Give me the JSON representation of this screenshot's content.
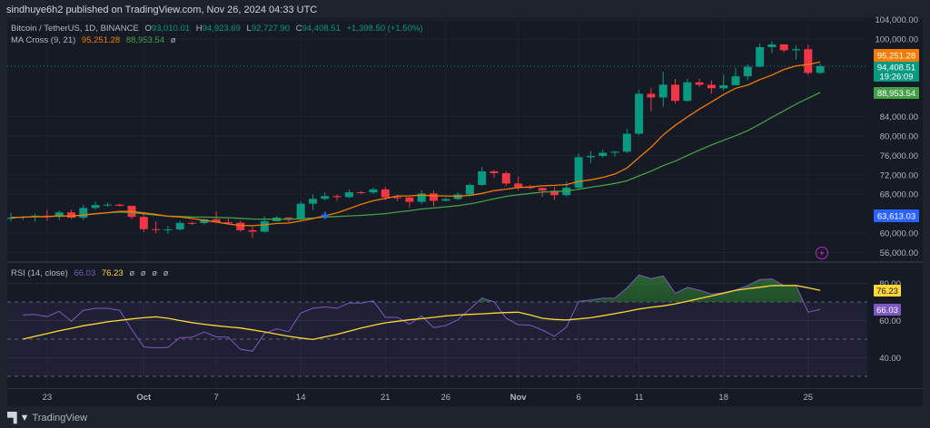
{
  "header": {
    "published": "sindhuye6h2 published on TradingView.com, Nov 26, 2024 04:33 UTC"
  },
  "legend": {
    "symbol": "Bitcoin / TetherUS, 1D, BINANCE",
    "o_label": "O",
    "o": "93,010.01",
    "h_label": "H",
    "h": "94,923.69",
    "l_label": "L",
    "l": "92,727.90",
    "c_label": "C",
    "c": "94,408.51",
    "change": "+1,398.50 (+1.50%)",
    "ma_name": "MA Cross (9, 21)",
    "ma_fast": "95,251.28",
    "ma_slow": "88,953.54",
    "ma_extra": "ø",
    "rsi_name": "RSI (14, close)",
    "rsi": "66.03",
    "rsi_ma": "76.23",
    "rsi_extra": [
      "ø",
      "ø",
      "ø",
      "ø"
    ]
  },
  "colors": {
    "up": "#089981",
    "down": "#f23645",
    "ma_fast": "#f57c00",
    "ma_slow": "#43a047",
    "rsi": "#7e57c2",
    "rsi_ma": "#fdd835",
    "crosshair": "#2962ff"
  },
  "price_axis": {
    "ticks": [
      "104,000.00",
      "100,000.00",
      "84,000.00",
      "80,000.00",
      "76,000.00",
      "72,000.00",
      "68,000.00",
      "60,000.00",
      "56,000.00"
    ],
    "tick_values": [
      104000,
      100000,
      84000,
      80000,
      76000,
      72000,
      68000,
      60000,
      56000
    ],
    "tags": {
      "ma_fast": "95,251.28",
      "last": "94,408.51",
      "countdown": "19:26:09",
      "ma_slow": "88,953.54",
      "crosshair": "63,613.03"
    },
    "last_value": 94408.51,
    "crosshair_value": 63613.03,
    "crosshair_date": "Oct 16"
  },
  "rsi_axis": {
    "ticks": [
      "80.00",
      "60.00",
      "40.00"
    ],
    "tick_values": [
      80,
      60,
      40
    ],
    "bands": [
      70,
      50,
      30
    ],
    "tags": {
      "rsi_ma": "76.23",
      "rsi": "66.03"
    }
  },
  "time_axis": [
    {
      "label": "23",
      "date": "Sep 23"
    },
    {
      "label": "Oct",
      "date": "Oct 1"
    },
    {
      "label": "7",
      "date": "Oct 7"
    },
    {
      "label": "14",
      "date": "Oct 14"
    },
    {
      "label": "21",
      "date": "Oct 21"
    },
    {
      "label": "26",
      "date": "Oct 26"
    },
    {
      "label": "Nov",
      "date": "Nov 1"
    },
    {
      "label": "6",
      "date": "Nov 6"
    },
    {
      "label": "11",
      "date": "Nov 11"
    },
    {
      "label": "18",
      "date": "Nov 18"
    },
    {
      "label": "25",
      "date": "Nov 25"
    }
  ],
  "chart_data": {
    "type": "candlestick",
    "ylim": [
      54000,
      104500
    ],
    "candles_columns": [
      "date",
      "open",
      "high",
      "low",
      "close"
    ],
    "candles": [
      [
        "Sep 20",
        62940,
        64133,
        62350,
        63192
      ],
      [
        "Sep 21",
        63192,
        63560,
        62760,
        63348
      ],
      [
        "Sep 22",
        63348,
        64000,
        62357,
        63578
      ],
      [
        "Sep 23",
        63578,
        64745,
        62538,
        63339
      ],
      [
        "Sep 24",
        63339,
        64688,
        62700,
        64262
      ],
      [
        "Sep 25",
        64262,
        64817,
        62947,
        63152
      ],
      [
        "Sep 26",
        63152,
        65839,
        62670,
        65173
      ],
      [
        "Sep 27",
        65173,
        66498,
        64819,
        65769
      ],
      [
        "Sep 28",
        65769,
        66260,
        65422,
        65858
      ],
      [
        "Sep 29",
        65858,
        66076,
        65432,
        65602
      ],
      [
        "Sep 30",
        65602,
        65618,
        62856,
        63327
      ],
      [
        "Oct 1",
        63327,
        64130,
        60164,
        60805
      ],
      [
        "Oct 2",
        60805,
        62390,
        59981,
        60649
      ],
      [
        "Oct 3",
        60649,
        61469,
        59828,
        60752
      ],
      [
        "Oct 4",
        60752,
        62484,
        60459,
        62086
      ],
      [
        "Oct 5",
        62086,
        62370,
        61689,
        62058
      ],
      [
        "Oct 6",
        62058,
        62975,
        61798,
        62819
      ],
      [
        "Oct 7",
        62819,
        64478,
        62128,
        62224
      ],
      [
        "Oct 8",
        62224,
        63200,
        61860,
        62131
      ],
      [
        "Oct 9",
        62131,
        62543,
        60300,
        60582
      ],
      [
        "Oct 10",
        60582,
        61320,
        58946,
        60274
      ],
      [
        "Oct 11",
        60274,
        63417,
        60080,
        62445
      ],
      [
        "Oct 12",
        62445,
        63480,
        62445,
        63193
      ],
      [
        "Oct 13",
        63193,
        63285,
        62050,
        62851
      ],
      [
        "Oct 14",
        62851,
        66500,
        62450,
        66047
      ],
      [
        "Oct 15",
        66047,
        67950,
        64800,
        67042
      ],
      [
        "Oct 16",
        67042,
        68424,
        66750,
        67612
      ],
      [
        "Oct 17",
        67612,
        67939,
        66666,
        67399
      ],
      [
        "Oct 18",
        67399,
        68969,
        67177,
        68418
      ],
      [
        "Oct 19",
        68418,
        68668,
        68022,
        68362
      ],
      [
        "Oct 20",
        68362,
        69400,
        68100,
        69001
      ],
      [
        "Oct 21",
        69001,
        69500,
        66800,
        67367
      ],
      [
        "Oct 22",
        67367,
        67836,
        66571,
        67361
      ],
      [
        "Oct 23",
        67361,
        67400,
        65260,
        66432
      ],
      [
        "Oct 24",
        66432,
        68850,
        66000,
        68161
      ],
      [
        "Oct 25",
        68161,
        68771,
        65522,
        66642
      ],
      [
        "Oct 26",
        66642,
        67316,
        66566,
        67014
      ],
      [
        "Oct 27",
        67014,
        68380,
        66777,
        67929
      ],
      [
        "Oct 28",
        67929,
        70270,
        67617,
        69907
      ],
      [
        "Oct 29",
        69907,
        73620,
        69730,
        72720
      ],
      [
        "Oct 30",
        72720,
        72984,
        71436,
        72339
      ],
      [
        "Oct 31",
        72339,
        72700,
        69685,
        70215
      ],
      [
        "Nov 1",
        70215,
        71632,
        68820,
        69482
      ],
      [
        "Nov 2",
        69482,
        69950,
        69000,
        69289
      ],
      [
        "Nov 3",
        69289,
        69403,
        67478,
        68741
      ],
      [
        "Nov 4",
        68741,
        69480,
        66835,
        67811
      ],
      [
        "Nov 5",
        67811,
        70577,
        67458,
        69359
      ],
      [
        "Nov 6",
        69359,
        76400,
        69050,
        75639
      ],
      [
        "Nov 7",
        75639,
        76850,
        74416,
        75904
      ],
      [
        "Nov 8",
        75904,
        77199,
        75556,
        76545
      ],
      [
        "Nov 9",
        76545,
        76932,
        75773,
        76778
      ],
      [
        "Nov 10",
        76778,
        81500,
        76492,
        80474
      ],
      [
        "Nov 11",
        80474,
        89530,
        80216,
        88701
      ],
      [
        "Nov 12",
        88701,
        89956,
        85072,
        87955
      ],
      [
        "Nov 13",
        87955,
        93265,
        86127,
        90584
      ],
      [
        "Nov 14",
        90584,
        91765,
        86668,
        87250
      ],
      [
        "Nov 15",
        87250,
        91790,
        87032,
        91066
      ],
      [
        "Nov 16",
        91066,
        91850,
        90092,
        90558
      ],
      [
        "Nov 17",
        90558,
        91450,
        88722,
        89845
      ],
      [
        "Nov 18",
        89845,
        92594,
        89376,
        90464
      ],
      [
        "Nov 19",
        90464,
        94002,
        90400,
        92310
      ],
      [
        "Nov 20",
        92310,
        94831,
        91500,
        94286
      ],
      [
        "Nov 21",
        94286,
        99073,
        94140,
        98317
      ],
      [
        "Nov 22",
        98317,
        99588,
        97122,
        98892
      ],
      [
        "Nov 23",
        98892,
        98935,
        97232,
        97672
      ],
      [
        "Nov 24",
        97672,
        98650,
        95764,
        97901
      ],
      [
        "Nov 25",
        97901,
        98871,
        92600,
        93010
      ],
      [
        "Nov 26",
        93010,
        94923.69,
        92727.9,
        94408.51
      ]
    ],
    "ma_periods": [
      9,
      21
    ],
    "rsi_start_date": "Sep 21",
    "rsi_ylim": [
      25,
      92
    ],
    "rsi": [
      63,
      63.3,
      62.1,
      65,
      59.6,
      65.5,
      66.6,
      66.6,
      65.5,
      55.2,
      45.8,
      45.3,
      45.6,
      50.8,
      51,
      53.8,
      51.2,
      51,
      44.6,
      43.5,
      53.1,
      55.5,
      54,
      64.1,
      66.6,
      67.3,
      66.6,
      69.4,
      69.4,
      70.6,
      61.7,
      61.7,
      58,
      62.5,
      56.2,
      57.3,
      60.4,
      66.2,
      72.1,
      70.1,
      61.2,
      57.8,
      57.5,
      54.9,
      51.5,
      56.5,
      70.3,
      71,
      72,
      72.1,
      77.5,
      84.5,
      82.6,
      84,
      74.7,
      77.8,
      76.3,
      74.2,
      75,
      76.5,
      78.8,
      82,
      82.4,
      78.8,
      78.8,
      64.5,
      66.03
    ],
    "rsi_ma": [
      50,
      51.5,
      53,
      54.5,
      55.8,
      57.2,
      58.2,
      59.3,
      60.1,
      60.9,
      61.5,
      62,
      61.2,
      60,
      58.9,
      58,
      57.2,
      56.6,
      56,
      55,
      53.9,
      52.7,
      51.5,
      50.6,
      49.8,
      51.2,
      52.6,
      54.3,
      56,
      57.4,
      58.8,
      59.6,
      60.4,
      61,
      61.7,
      62.5,
      63,
      63.3,
      63.6,
      64,
      64.3,
      64.5,
      63,
      61.2,
      60.6,
      60.3,
      60.9,
      61.5,
      62.6,
      63.7,
      64.9,
      66.2,
      67.1,
      67.9,
      69,
      70.4,
      71.8,
      73.2,
      74.7,
      76.3,
      77.1,
      77.9,
      78.8,
      78.9,
      78.9,
      77.6,
      76.23
    ]
  },
  "footer": {
    "brand": "TradingView"
  }
}
